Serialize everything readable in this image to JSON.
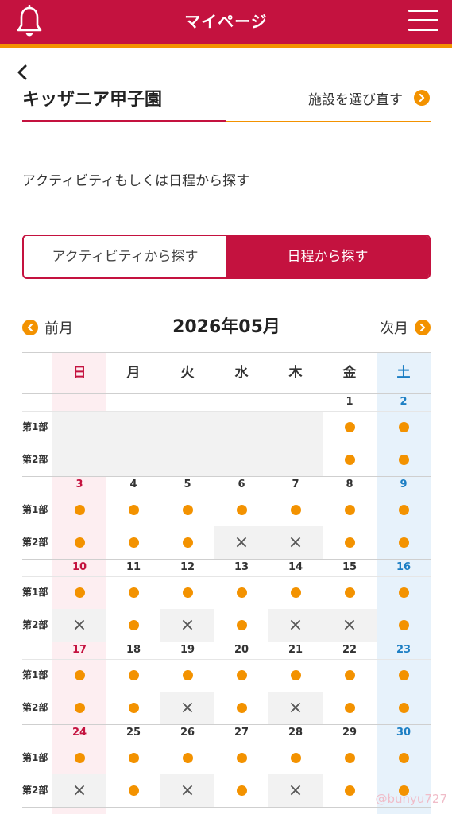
{
  "header": {
    "title": "マイページ",
    "bell_icon": "bell-icon",
    "menu_icon": "hamburger-menu-icon",
    "bg_color": "#c4123f",
    "accent_color": "#f39200"
  },
  "facility": {
    "back_icon": "chevron-left-icon",
    "name": "キッザニア甲子園",
    "reselect_label": "施設を選び直す",
    "reselect_icon": "chevron-right-icon"
  },
  "instruction": "アクティビティもしくは日程から探す",
  "search_tabs": [
    {
      "label": "アクティビティから探す",
      "selected": false
    },
    {
      "label": "日程から探す",
      "selected": true
    }
  ],
  "month_nav": {
    "prev_label": "前月",
    "current": "2026年05月",
    "next_label": "次月"
  },
  "calendar": {
    "weekdays": [
      "日",
      "月",
      "火",
      "水",
      "木",
      "金",
      "土"
    ],
    "sessions": [
      "第1部",
      "第2部"
    ],
    "colors": {
      "sunday": "#c4123f",
      "saturday": "#1d7fc4",
      "sunday_bg": "#fdeef1",
      "saturday_bg": "#e7f2fb",
      "available": "#f39200"
    },
    "weeks": [
      {
        "days": [
          "",
          "",
          "",
          "",
          "",
          "1",
          "2"
        ],
        "s1": [
          "",
          "",
          "",
          "",
          "",
          "o",
          "o"
        ],
        "s2": [
          "",
          "",
          "",
          "",
          "",
          "o",
          "o"
        ]
      },
      {
        "days": [
          "3",
          "4",
          "5",
          "6",
          "7",
          "8",
          "9"
        ],
        "s1": [
          "o",
          "o",
          "o",
          "o",
          "o",
          "o",
          "o"
        ],
        "s2": [
          "o",
          "o",
          "o",
          "x",
          "x",
          "o",
          "o"
        ]
      },
      {
        "days": [
          "10",
          "11",
          "12",
          "13",
          "14",
          "15",
          "16"
        ],
        "s1": [
          "o",
          "o",
          "o",
          "o",
          "o",
          "o",
          "o"
        ],
        "s2": [
          "x",
          "o",
          "x",
          "o",
          "x",
          "x",
          "o"
        ]
      },
      {
        "days": [
          "17",
          "18",
          "19",
          "20",
          "21",
          "22",
          "23"
        ],
        "s1": [
          "o",
          "o",
          "o",
          "o",
          "o",
          "o",
          "o"
        ],
        "s2": [
          "o",
          "o",
          "x",
          "o",
          "x",
          "o",
          "o"
        ]
      },
      {
        "days": [
          "24",
          "25",
          "26",
          "27",
          "28",
          "29",
          "30"
        ],
        "s1": [
          "o",
          "o",
          "o",
          "o",
          "o",
          "o",
          "o"
        ],
        "s2": [
          "x",
          "o",
          "x",
          "o",
          "x",
          "o",
          "o"
        ]
      }
    ],
    "available_symbol": "available-dot-icon",
    "unavailable_symbol": "×"
  },
  "watermark": "@bunyu727"
}
